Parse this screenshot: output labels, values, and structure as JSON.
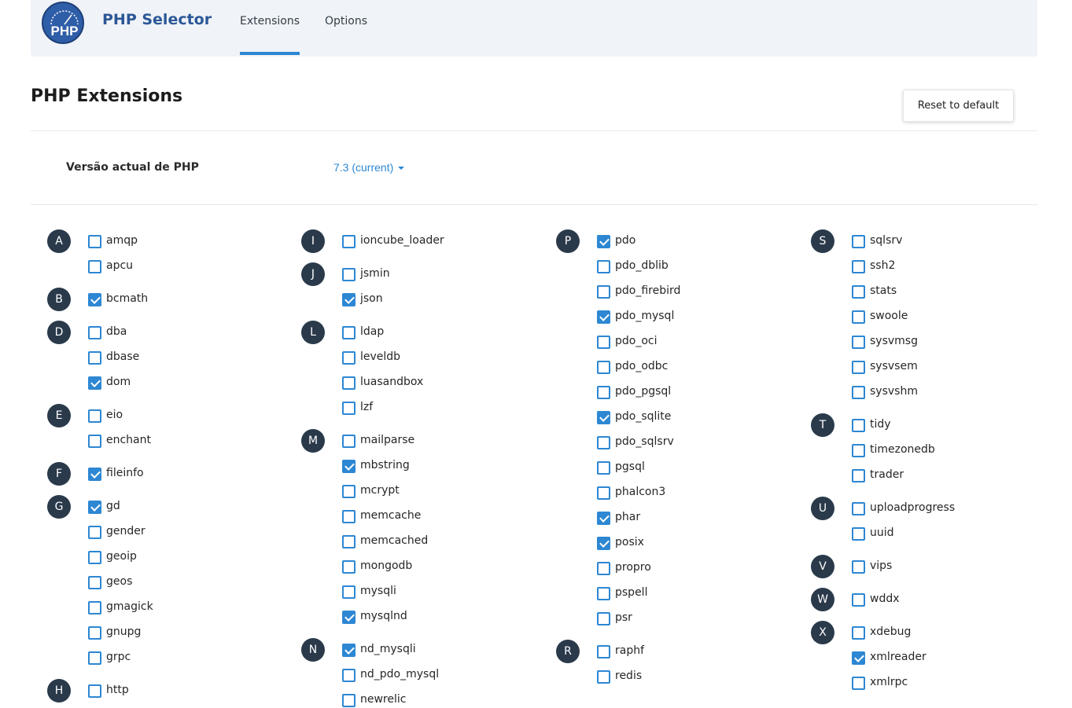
{
  "app": {
    "title": "PHP Selector",
    "logo_text": "PHP"
  },
  "tabs": [
    {
      "label": "Extensions",
      "active": true
    },
    {
      "label": "Options",
      "active": false
    }
  ],
  "page": {
    "title": "PHP Extensions",
    "reset_label": "Reset to default"
  },
  "version": {
    "label": "Versão actual de PHP",
    "value": "7.3 (current)"
  },
  "colors": {
    "accent": "#2d87d3",
    "letter_bg": "#2a3a4b",
    "brand": "#2b5797",
    "topbar_bg": "#f0f3f7"
  },
  "columns": [
    {
      "groups": [
        {
          "letter": "A",
          "exts": [
            {
              "name": "amqp",
              "checked": false
            },
            {
              "name": "apcu",
              "checked": false
            }
          ]
        },
        {
          "letter": "B",
          "exts": [
            {
              "name": "bcmath",
              "checked": true
            }
          ]
        },
        {
          "letter": "D",
          "exts": [
            {
              "name": "dba",
              "checked": false
            },
            {
              "name": "dbase",
              "checked": false
            },
            {
              "name": "dom",
              "checked": true
            }
          ]
        },
        {
          "letter": "E",
          "exts": [
            {
              "name": "eio",
              "checked": false
            },
            {
              "name": "enchant",
              "checked": false
            }
          ]
        },
        {
          "letter": "F",
          "exts": [
            {
              "name": "fileinfo",
              "checked": true
            }
          ]
        },
        {
          "letter": "G",
          "exts": [
            {
              "name": "gd",
              "checked": true
            },
            {
              "name": "gender",
              "checked": false
            },
            {
              "name": "geoip",
              "checked": false
            },
            {
              "name": "geos",
              "checked": false
            },
            {
              "name": "gmagick",
              "checked": false
            },
            {
              "name": "gnupg",
              "checked": false
            },
            {
              "name": "grpc",
              "checked": false
            }
          ]
        },
        {
          "letter": "H",
          "exts": [
            {
              "name": "http",
              "checked": false
            }
          ]
        }
      ]
    },
    {
      "groups": [
        {
          "letter": "I",
          "exts": [
            {
              "name": "ioncube_loader",
              "checked": false
            }
          ]
        },
        {
          "letter": "J",
          "exts": [
            {
              "name": "jsmin",
              "checked": false
            },
            {
              "name": "json",
              "checked": true
            }
          ]
        },
        {
          "letter": "L",
          "exts": [
            {
              "name": "ldap",
              "checked": false
            },
            {
              "name": "leveldb",
              "checked": false
            },
            {
              "name": "luasandbox",
              "checked": false
            },
            {
              "name": "lzf",
              "checked": false
            }
          ]
        },
        {
          "letter": "M",
          "exts": [
            {
              "name": "mailparse",
              "checked": false
            },
            {
              "name": "mbstring",
              "checked": true
            },
            {
              "name": "mcrypt",
              "checked": false
            },
            {
              "name": "memcache",
              "checked": false
            },
            {
              "name": "memcached",
              "checked": false
            },
            {
              "name": "mongodb",
              "checked": false
            },
            {
              "name": "mysqli",
              "checked": false
            },
            {
              "name": "mysqlnd",
              "checked": true
            }
          ]
        },
        {
          "letter": "N",
          "exts": [
            {
              "name": "nd_mysqli",
              "checked": true
            },
            {
              "name": "nd_pdo_mysql",
              "checked": false
            },
            {
              "name": "newrelic",
              "checked": false
            }
          ]
        }
      ]
    },
    {
      "groups": [
        {
          "letter": "P",
          "exts": [
            {
              "name": "pdo",
              "checked": true
            },
            {
              "name": "pdo_dblib",
              "checked": false
            },
            {
              "name": "pdo_firebird",
              "checked": false
            },
            {
              "name": "pdo_mysql",
              "checked": true
            },
            {
              "name": "pdo_oci",
              "checked": false
            },
            {
              "name": "pdo_odbc",
              "checked": false
            },
            {
              "name": "pdo_pgsql",
              "checked": false
            },
            {
              "name": "pdo_sqlite",
              "checked": true
            },
            {
              "name": "pdo_sqlsrv",
              "checked": false
            },
            {
              "name": "pgsql",
              "checked": false
            },
            {
              "name": "phalcon3",
              "checked": false
            },
            {
              "name": "phar",
              "checked": true
            },
            {
              "name": "posix",
              "checked": true
            },
            {
              "name": "propro",
              "checked": false
            },
            {
              "name": "pspell",
              "checked": false
            },
            {
              "name": "psr",
              "checked": false
            }
          ]
        },
        {
          "letter": "R",
          "exts": [
            {
              "name": "raphf",
              "checked": false
            },
            {
              "name": "redis",
              "checked": false
            }
          ]
        }
      ]
    },
    {
      "groups": [
        {
          "letter": "S",
          "exts": [
            {
              "name": "sqlsrv",
              "checked": false
            },
            {
              "name": "ssh2",
              "checked": false
            },
            {
              "name": "stats",
              "checked": false
            },
            {
              "name": "swoole",
              "checked": false
            },
            {
              "name": "sysvmsg",
              "checked": false
            },
            {
              "name": "sysvsem",
              "checked": false
            },
            {
              "name": "sysvshm",
              "checked": false
            }
          ]
        },
        {
          "letter": "T",
          "exts": [
            {
              "name": "tidy",
              "checked": false
            },
            {
              "name": "timezonedb",
              "checked": false
            },
            {
              "name": "trader",
              "checked": false
            }
          ]
        },
        {
          "letter": "U",
          "exts": [
            {
              "name": "uploadprogress",
              "checked": false
            },
            {
              "name": "uuid",
              "checked": false
            }
          ]
        },
        {
          "letter": "V",
          "exts": [
            {
              "name": "vips",
              "checked": false
            }
          ]
        },
        {
          "letter": "W",
          "exts": [
            {
              "name": "wddx",
              "checked": false
            }
          ]
        },
        {
          "letter": "X",
          "exts": [
            {
              "name": "xdebug",
              "checked": false
            },
            {
              "name": "xmlreader",
              "checked": true
            },
            {
              "name": "xmlrpc",
              "checked": false
            }
          ]
        }
      ]
    }
  ]
}
